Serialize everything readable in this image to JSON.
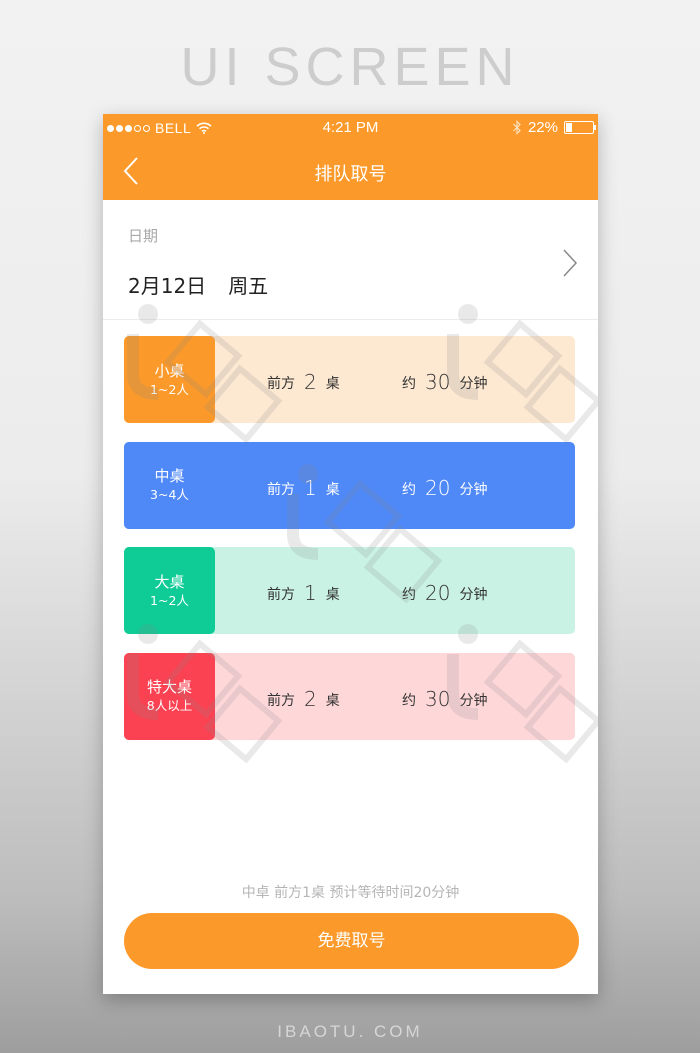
{
  "poster": {
    "title": "UI SCREEN",
    "footer": "IBAOTU. COM"
  },
  "status_bar": {
    "signal_filled": 3,
    "signal_total": 5,
    "carrier": "BELL",
    "wifi_icon": "wifi-icon",
    "time": "4:21 PM",
    "bluetooth_icon": "bluetooth-icon",
    "battery_percent": "22%",
    "battery_level": 0.22
  },
  "nav": {
    "back_icon": "chevron-left-icon",
    "title": "排队取号"
  },
  "date": {
    "label": "日期",
    "day": "2月12日",
    "weekday": "周五",
    "chevron_icon": "chevron-right-icon"
  },
  "tables": [
    {
      "name": "小桌",
      "size": "1~2人",
      "ahead_prefix": "前方",
      "ahead_count": "2",
      "ahead_unit": "桌",
      "wait_prefix": "约",
      "wait_minutes": "30",
      "wait_unit": "分钟",
      "badge_color": "#fb9a2a",
      "card_color": "#fde8d2",
      "selected": false
    },
    {
      "name": "中桌",
      "size": "3~4人",
      "ahead_prefix": "前方",
      "ahead_count": "1",
      "ahead_unit": "桌",
      "wait_prefix": "约",
      "wait_minutes": "20",
      "wait_unit": "分钟",
      "badge_color": "#4f88f7",
      "card_color": "#4f88f7",
      "selected": true
    },
    {
      "name": "大桌",
      "size": "1~2人",
      "ahead_prefix": "前方",
      "ahead_count": "1",
      "ahead_unit": "桌",
      "wait_prefix": "约",
      "wait_minutes": "20",
      "wait_unit": "分钟",
      "badge_color": "#0fcb96",
      "card_color": "#c9f2e5",
      "selected": false
    },
    {
      "name": "特大桌",
      "size": "8人以上",
      "ahead_prefix": "前方",
      "ahead_count": "2",
      "ahead_unit": "桌",
      "wait_prefix": "约",
      "wait_minutes": "30",
      "wait_unit": "分钟",
      "badge_color": "#fa4252",
      "card_color": "#fed7d9",
      "selected": false
    }
  ],
  "summary": "中卓  前方1桌  预计等待时间20分钟",
  "action_button": "免费取号",
  "colors": {
    "brand": "#fb9a2a",
    "selected": "#4f88f7"
  }
}
